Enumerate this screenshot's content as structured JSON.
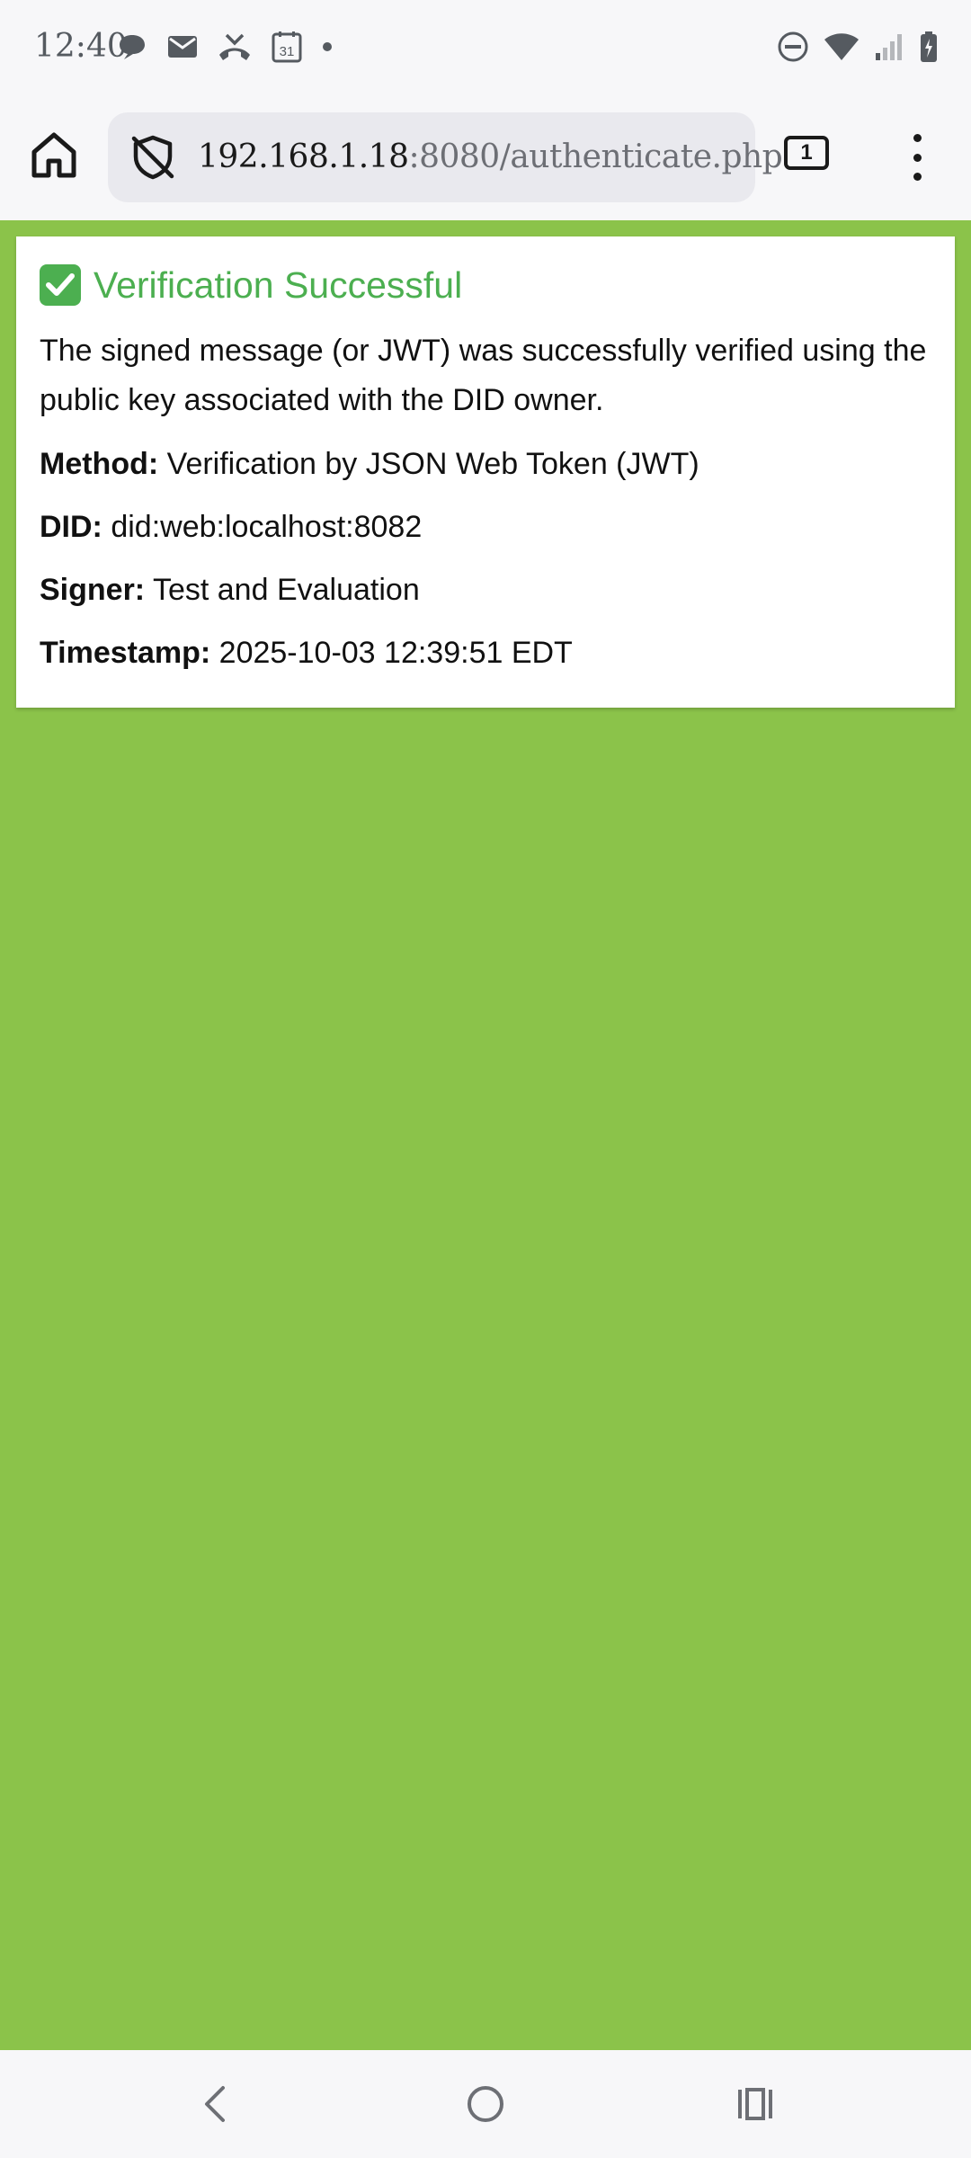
{
  "status_bar": {
    "time": "12:40",
    "calendar_day": "31"
  },
  "browser": {
    "url_host": "192.168.1.18",
    "url_path": ":8080/authenticate.php",
    "tab_count": "1"
  },
  "card": {
    "title": "Verification Successful",
    "description": "The signed message (or JWT) was successfully verified using the public key associated with the DID owner.",
    "fields": [
      {
        "label": "Method:",
        "value": "Verification by JSON Web Token (JWT)"
      },
      {
        "label": "DID:",
        "value": "did:web:localhost:8082"
      },
      {
        "label": "Signer:",
        "value": "Test and Evaluation"
      },
      {
        "label": "Timestamp:",
        "value": "2025-10-03 12:39:51 EDT"
      }
    ]
  },
  "colors": {
    "page_background": "#8bc34a",
    "success_green": "#4caf50",
    "card_background": "#ffffff"
  },
  "icons": {
    "status_left": [
      "chat-bubble-icon",
      "mail-icon",
      "missed-call-icon",
      "calendar-icon",
      "dot-icon"
    ],
    "status_right": [
      "do-not-disturb-icon",
      "wifi-icon",
      "signal-icon",
      "battery-icon"
    ],
    "toolbar": [
      "home-icon",
      "shield-off-icon",
      "tabs-icon",
      "more-menu-icon"
    ],
    "navigation": [
      "back-icon",
      "home-circle-icon",
      "recents-icon"
    ]
  }
}
